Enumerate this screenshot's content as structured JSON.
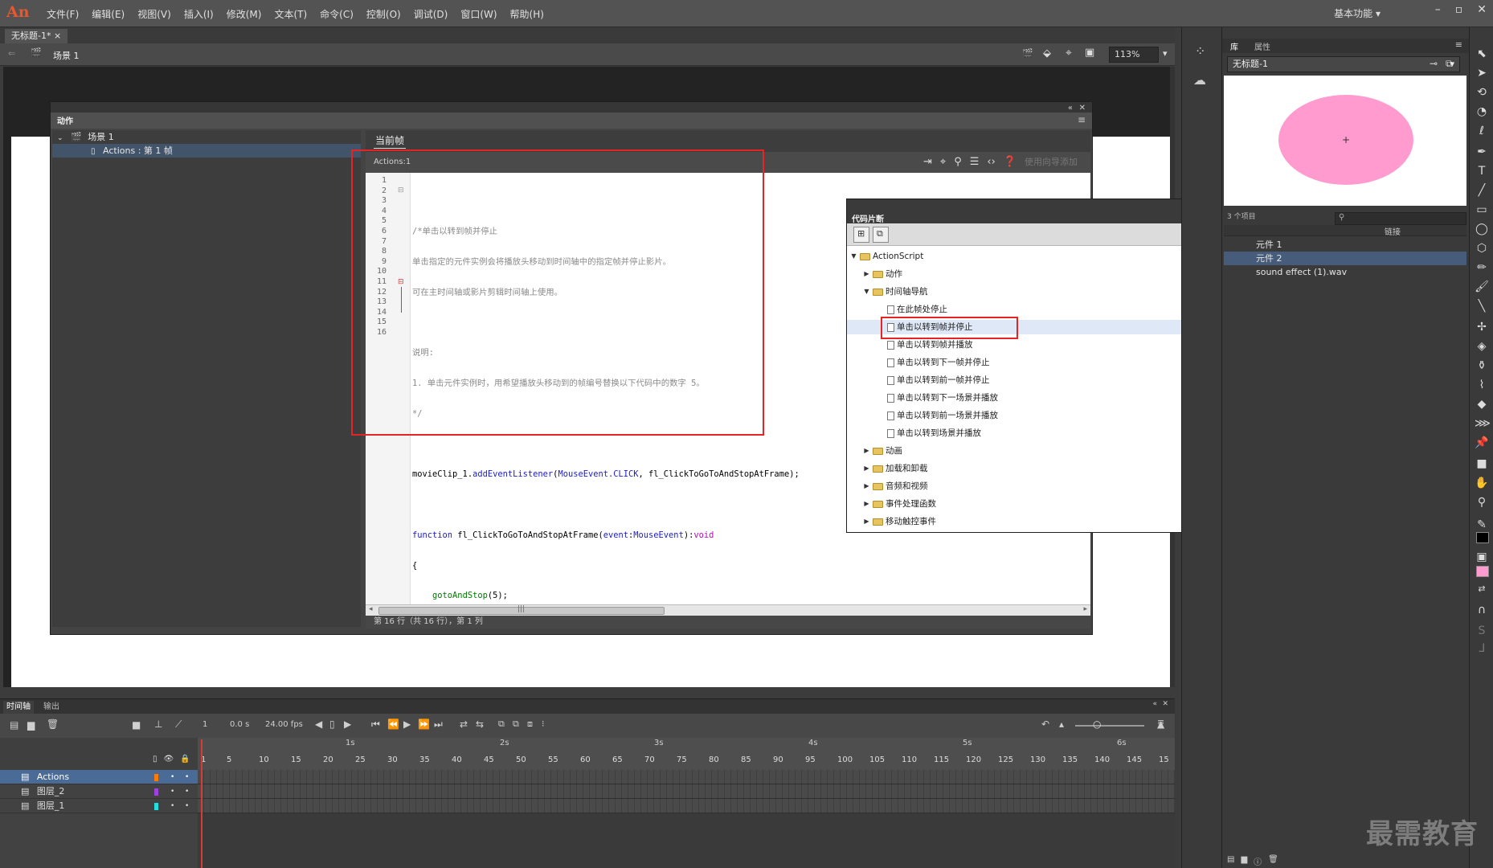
{
  "app": {
    "logo": "An",
    "menus": [
      "文件(F)",
      "编辑(E)",
      "视图(V)",
      "插入(I)",
      "修改(M)",
      "文本(T)",
      "命令(C)",
      "控制(O)",
      "调试(D)",
      "窗口(W)",
      "帮助(H)"
    ],
    "workspace": "基本功能"
  },
  "document": {
    "tab": "无标题-1*",
    "scene": "场景 1",
    "zoom": "113%"
  },
  "actions_panel": {
    "title": "动作",
    "tree": {
      "scene": "场景 1",
      "item": "Actions : 第 1 帧"
    },
    "code_tab": "当前帧",
    "code_path": "Actions:1",
    "assist_label": "使用向导添加",
    "line_numbers": [
      "1",
      "2",
      "3",
      "4",
      "5",
      "6",
      "7",
      "8",
      "9",
      "10",
      "11",
      "12",
      "13",
      "14",
      "15",
      "16"
    ],
    "code": {
      "l2": "/*单击以转到帧并停止",
      "l3": "单击指定的元件实例会将播放头移动到时间轴中的指定帧并停止影片。",
      "l4": "可在主时间轴或影片剪辑时间轴上使用。",
      "l6": "说明:",
      "l7": "1. 单击元件实例时，用希望播放头移动到的帧编号替换以下代码中的数字 5。",
      "l8": "*/",
      "l10_a": "movieClip_1.",
      "l10_b": "addEventListener",
      "l10_c": "(",
      "l10_d": "MouseEvent.CLICK",
      "l10_e": ", fl_ClickToGoToAndStopAtFrame);",
      "l12_a": "function",
      "l12_b": " fl_ClickToGoToAndStopAtFrame(",
      "l12_c": "event",
      "l12_d": ":",
      "l12_e": "MouseEvent",
      "l12_f": "):",
      "l12_g": "void",
      "l13": "{",
      "l14_a": "    ",
      "l14_b": "gotoAndStop",
      "l14_c": "(5);",
      "l15": "}"
    },
    "hscroll_grip": "|||",
    "status": "第 16 行（共 16 行），第 1 列"
  },
  "code_snippets": {
    "title": "代码片断",
    "root": "ActionScript",
    "items": [
      {
        "label": "动作",
        "type": "folder",
        "level": 1,
        "open": false
      },
      {
        "label": "时间轴导航",
        "type": "folder",
        "level": 1,
        "open": true
      },
      {
        "label": "在此帧处停止",
        "type": "file",
        "level": 2
      },
      {
        "label": "单击以转到帧并停止",
        "type": "file",
        "level": 2,
        "highlight": true
      },
      {
        "label": "单击以转到帧并播放",
        "type": "file",
        "level": 2
      },
      {
        "label": "单击以转到下一帧并停止",
        "type": "file",
        "level": 2
      },
      {
        "label": "单击以转到前一帧并停止",
        "type": "file",
        "level": 2
      },
      {
        "label": "单击以转到下一场景并播放",
        "type": "file",
        "level": 2
      },
      {
        "label": "单击以转到前一场景并播放",
        "type": "file",
        "level": 2
      },
      {
        "label": "单击以转到场景并播放",
        "type": "file",
        "level": 2
      },
      {
        "label": "动画",
        "type": "folder",
        "level": 1,
        "open": false
      },
      {
        "label": "加载和卸载",
        "type": "folder",
        "level": 1,
        "open": false
      },
      {
        "label": "音频和视频",
        "type": "folder",
        "level": 1,
        "open": false
      },
      {
        "label": "事件处理函数",
        "type": "folder",
        "level": 1,
        "open": false
      },
      {
        "label": "移动触控事件",
        "type": "folder",
        "level": 1,
        "open": false
      }
    ]
  },
  "timeline": {
    "tabs": [
      "时间轴",
      "输出"
    ],
    "current_frame": "1",
    "time": "0.0 s",
    "fps": "24.00 fps",
    "seconds": [
      "1s",
      "2s",
      "3s",
      "4s",
      "5s",
      "6s"
    ],
    "frame_ticks": [
      "1",
      "5",
      "10",
      "15",
      "20",
      "25",
      "30",
      "35",
      "40",
      "45",
      "50",
      "55",
      "60",
      "65",
      "70",
      "75",
      "80",
      "85",
      "90",
      "95",
      "100",
      "105",
      "110",
      "115",
      "120",
      "125",
      "130",
      "135",
      "140",
      "145",
      "15"
    ],
    "layers": [
      {
        "name": "Actions",
        "color": "#ff7a00",
        "selected": true
      },
      {
        "name": "图层_2",
        "color": "#a040e0",
        "selected": false
      },
      {
        "name": "图层_1",
        "color": "#20e0e0",
        "selected": false
      }
    ]
  },
  "library": {
    "tabs": [
      "库",
      "属性"
    ],
    "document": "无标题-1",
    "item_count": "3 个项目",
    "column": "链接",
    "items": [
      {
        "name": "元件 1",
        "selected": false
      },
      {
        "name": "元件 2",
        "selected": true
      },
      {
        "name": "sound effect (1).wav",
        "selected": false
      }
    ],
    "preview_color": "#ff9bcf"
  },
  "watermark": "最需教育"
}
